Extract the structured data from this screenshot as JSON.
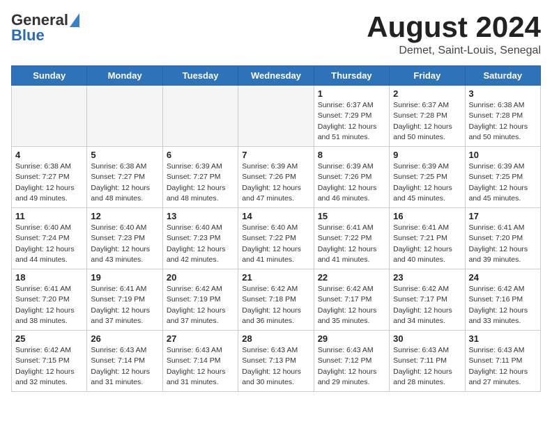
{
  "header": {
    "logo_general": "General",
    "logo_blue": "Blue",
    "month_title": "August 2024",
    "location": "Demet, Saint-Louis, Senegal"
  },
  "days_of_week": [
    "Sunday",
    "Monday",
    "Tuesday",
    "Wednesday",
    "Thursday",
    "Friday",
    "Saturday"
  ],
  "weeks": [
    [
      {
        "day": "",
        "empty": true
      },
      {
        "day": "",
        "empty": true
      },
      {
        "day": "",
        "empty": true
      },
      {
        "day": "",
        "empty": true
      },
      {
        "day": "1",
        "sunrise": "6:37 AM",
        "sunset": "7:29 PM",
        "daylight": "12 hours and 51 minutes."
      },
      {
        "day": "2",
        "sunrise": "6:37 AM",
        "sunset": "7:28 PM",
        "daylight": "12 hours and 50 minutes."
      },
      {
        "day": "3",
        "sunrise": "6:38 AM",
        "sunset": "7:28 PM",
        "daylight": "12 hours and 50 minutes."
      }
    ],
    [
      {
        "day": "4",
        "sunrise": "6:38 AM",
        "sunset": "7:27 PM",
        "daylight": "12 hours and 49 minutes."
      },
      {
        "day": "5",
        "sunrise": "6:38 AM",
        "sunset": "7:27 PM",
        "daylight": "12 hours and 48 minutes."
      },
      {
        "day": "6",
        "sunrise": "6:39 AM",
        "sunset": "7:27 PM",
        "daylight": "12 hours and 48 minutes."
      },
      {
        "day": "7",
        "sunrise": "6:39 AM",
        "sunset": "7:26 PM",
        "daylight": "12 hours and 47 minutes."
      },
      {
        "day": "8",
        "sunrise": "6:39 AM",
        "sunset": "7:26 PM",
        "daylight": "12 hours and 46 minutes."
      },
      {
        "day": "9",
        "sunrise": "6:39 AM",
        "sunset": "7:25 PM",
        "daylight": "12 hours and 45 minutes."
      },
      {
        "day": "10",
        "sunrise": "6:39 AM",
        "sunset": "7:25 PM",
        "daylight": "12 hours and 45 minutes."
      }
    ],
    [
      {
        "day": "11",
        "sunrise": "6:40 AM",
        "sunset": "7:24 PM",
        "daylight": "12 hours and 44 minutes."
      },
      {
        "day": "12",
        "sunrise": "6:40 AM",
        "sunset": "7:23 PM",
        "daylight": "12 hours and 43 minutes."
      },
      {
        "day": "13",
        "sunrise": "6:40 AM",
        "sunset": "7:23 PM",
        "daylight": "12 hours and 42 minutes."
      },
      {
        "day": "14",
        "sunrise": "6:40 AM",
        "sunset": "7:22 PM",
        "daylight": "12 hours and 41 minutes."
      },
      {
        "day": "15",
        "sunrise": "6:41 AM",
        "sunset": "7:22 PM",
        "daylight": "12 hours and 41 minutes."
      },
      {
        "day": "16",
        "sunrise": "6:41 AM",
        "sunset": "7:21 PM",
        "daylight": "12 hours and 40 minutes."
      },
      {
        "day": "17",
        "sunrise": "6:41 AM",
        "sunset": "7:20 PM",
        "daylight": "12 hours and 39 minutes."
      }
    ],
    [
      {
        "day": "18",
        "sunrise": "6:41 AM",
        "sunset": "7:20 PM",
        "daylight": "12 hours and 38 minutes."
      },
      {
        "day": "19",
        "sunrise": "6:41 AM",
        "sunset": "7:19 PM",
        "daylight": "12 hours and 37 minutes."
      },
      {
        "day": "20",
        "sunrise": "6:42 AM",
        "sunset": "7:19 PM",
        "daylight": "12 hours and 37 minutes."
      },
      {
        "day": "21",
        "sunrise": "6:42 AM",
        "sunset": "7:18 PM",
        "daylight": "12 hours and 36 minutes."
      },
      {
        "day": "22",
        "sunrise": "6:42 AM",
        "sunset": "7:17 PM",
        "daylight": "12 hours and 35 minutes."
      },
      {
        "day": "23",
        "sunrise": "6:42 AM",
        "sunset": "7:17 PM",
        "daylight": "12 hours and 34 minutes."
      },
      {
        "day": "24",
        "sunrise": "6:42 AM",
        "sunset": "7:16 PM",
        "daylight": "12 hours and 33 minutes."
      }
    ],
    [
      {
        "day": "25",
        "sunrise": "6:42 AM",
        "sunset": "7:15 PM",
        "daylight": "12 hours and 32 minutes."
      },
      {
        "day": "26",
        "sunrise": "6:43 AM",
        "sunset": "7:14 PM",
        "daylight": "12 hours and 31 minutes."
      },
      {
        "day": "27",
        "sunrise": "6:43 AM",
        "sunset": "7:14 PM",
        "daylight": "12 hours and 31 minutes."
      },
      {
        "day": "28",
        "sunrise": "6:43 AM",
        "sunset": "7:13 PM",
        "daylight": "12 hours and 30 minutes."
      },
      {
        "day": "29",
        "sunrise": "6:43 AM",
        "sunset": "7:12 PM",
        "daylight": "12 hours and 29 minutes."
      },
      {
        "day": "30",
        "sunrise": "6:43 AM",
        "sunset": "7:11 PM",
        "daylight": "12 hours and 28 minutes."
      },
      {
        "day": "31",
        "sunrise": "6:43 AM",
        "sunset": "7:11 PM",
        "daylight": "12 hours and 27 minutes."
      }
    ]
  ]
}
